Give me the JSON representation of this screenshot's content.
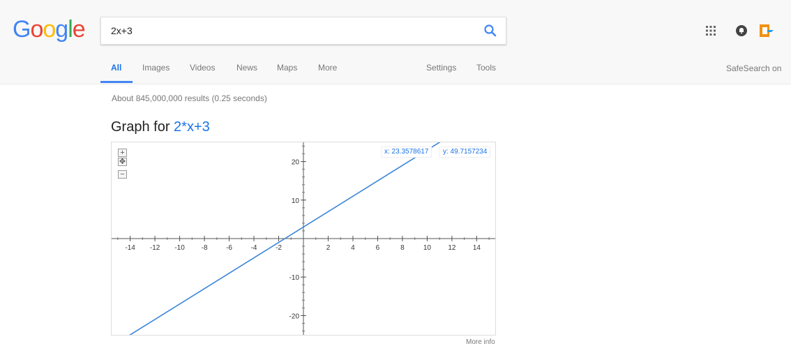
{
  "logo": [
    "G",
    "o",
    "o",
    "g",
    "l",
    "e"
  ],
  "search": {
    "value": "2x+3"
  },
  "tabs": [
    {
      "label": "All",
      "active": true
    },
    {
      "label": "Images"
    },
    {
      "label": "Videos"
    },
    {
      "label": "News"
    },
    {
      "label": "Maps"
    },
    {
      "label": "More"
    }
  ],
  "tools": {
    "settings": "Settings",
    "tools": "Tools"
  },
  "safesearch": "SafeSearch on",
  "stats": "About 845,000,000 results (0.25 seconds)",
  "graph": {
    "title_prefix": "Graph for ",
    "expression": "2*x+3",
    "coord_x": "x: 23.3578617",
    "coord_y": "y: 49.7157234",
    "more_info": "More info",
    "zoom_in": "+",
    "zoom_out": "−",
    "pan": "✥"
  },
  "icons": {
    "apps": "apps-grid-icon",
    "notifications": "notifications-bell-icon",
    "profile": "account-icon",
    "search": "search-icon"
  },
  "colors": {
    "accent": "#4285f4",
    "link": "#1a73e8",
    "line": "#3a85d8"
  },
  "chart_data": {
    "type": "line",
    "function": "y = 2x + 3",
    "xlim": [
      -15.5,
      15.5
    ],
    "ylim": [
      -25,
      25
    ],
    "x_ticks": [
      -14,
      -12,
      -10,
      -8,
      -6,
      -4,
      -2,
      2,
      4,
      6,
      8,
      10,
      12,
      14
    ],
    "y_ticks": [
      -20,
      -10,
      10,
      20
    ],
    "series": [
      {
        "x": [
          -15.5,
          15.5
        ],
        "y": [
          -28,
          34
        ]
      }
    ]
  }
}
